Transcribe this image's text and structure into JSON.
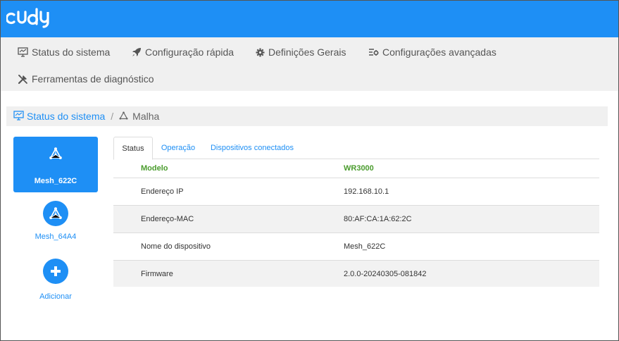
{
  "brand": {
    "logo_text": "cudy",
    "color": "#1e8ff5"
  },
  "nav": {
    "items": [
      {
        "label": "Status do sistema",
        "icon": "monitor-icon"
      },
      {
        "label": "Configuração rápida",
        "icon": "rocket-icon"
      },
      {
        "label": "Definições Gerais",
        "icon": "gear-icon"
      },
      {
        "label": "Configurações avançadas",
        "icon": "advanced-settings-icon"
      },
      {
        "label": "Ferramentas de diagnóstico",
        "icon": "tools-icon"
      }
    ]
  },
  "breadcrumb": {
    "root": "Status do sistema",
    "separator": "/",
    "current": "Malha"
  },
  "mesh_nodes": {
    "active": {
      "label": "Mesh_622C",
      "icon": "mesh-node-icon"
    },
    "secondary": {
      "label": "Mesh_64A4",
      "icon": "mesh-node-icon"
    },
    "add": {
      "label": "Adicionar",
      "icon": "plus-icon"
    }
  },
  "tabs": [
    {
      "label": "Status",
      "active": true
    },
    {
      "label": "Operação",
      "active": false
    },
    {
      "label": "Dispositivos conectados",
      "active": false
    }
  ],
  "details": {
    "header": {
      "key": "Modelo",
      "value": "WR3000"
    },
    "rows": [
      {
        "key": "Endereço IP",
        "value": "192.168.10.1"
      },
      {
        "key": "Endereço-MAC",
        "value": "80:AF:CA:1A:62:2C"
      },
      {
        "key": "Nome do dispositivo",
        "value": "Mesh_622C"
      },
      {
        "key": "Firmware",
        "value": "2.0.0-20240305-081842"
      }
    ]
  }
}
